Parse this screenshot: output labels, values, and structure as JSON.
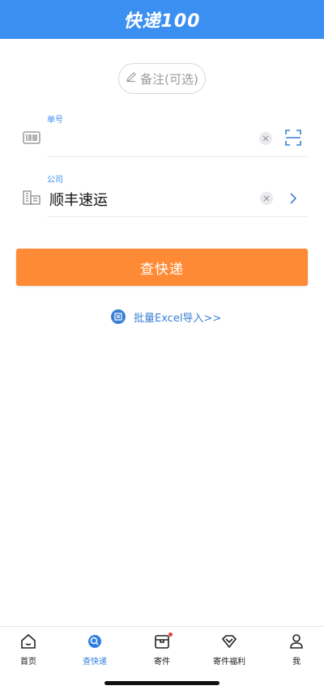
{
  "header": {
    "logo_text": "快递100"
  },
  "note_button": {
    "label": "备注(可选)",
    "icon": "pencil-icon"
  },
  "tracking_field": {
    "label": "单号",
    "value": "",
    "placeholder": "",
    "left_icon": "barcode-icon",
    "right_icon": "scan-icon"
  },
  "company_field": {
    "label": "公司",
    "value": "顺丰速运",
    "left_icon": "buildings-icon",
    "right_icon": "chevron-right-icon"
  },
  "query_button": {
    "label": "查快递"
  },
  "excel_link": {
    "label": "批量Excel导入>>",
    "icon": "excel-icon"
  },
  "tabbar": {
    "items": [
      {
        "label": "首页",
        "icon": "home-icon",
        "active": false
      },
      {
        "label": "查快递",
        "icon": "search-icon",
        "active": true
      },
      {
        "label": "寄件",
        "icon": "package-icon",
        "active": false,
        "badge_dot": true
      },
      {
        "label": "寄件福利",
        "icon": "heart-gift-icon",
        "active": false
      },
      {
        "label": "我",
        "icon": "user-icon",
        "active": false
      }
    ]
  },
  "colors": {
    "brand_blue": "#3a8ff0",
    "query_orange": "#ff8a35",
    "active_tab": "#2f7fe0"
  }
}
